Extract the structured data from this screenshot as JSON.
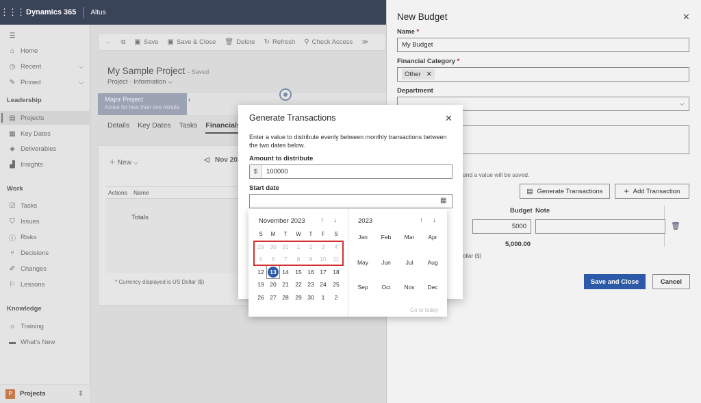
{
  "topbar": {
    "waffle": "⋮⋮⋮",
    "app_name": "Dynamics 365",
    "environment": "Altus"
  },
  "sidebar": {
    "top_items": [
      {
        "label": "Home",
        "icon": "home-icon"
      },
      {
        "label": "Recent",
        "icon": "clock-icon"
      },
      {
        "label": "Pinned",
        "icon": "pin-icon"
      }
    ],
    "groups": [
      {
        "title": "Leadership",
        "items": [
          {
            "label": "Projects",
            "icon": "projects-icon",
            "active": true
          },
          {
            "label": "Key Dates",
            "icon": "calendar-icon"
          },
          {
            "label": "Deliverables",
            "icon": "cube-icon"
          },
          {
            "label": "Insights",
            "icon": "chart-icon"
          }
        ]
      },
      {
        "title": "Work",
        "items": [
          {
            "label": "Tasks",
            "icon": "checkbox-icon"
          },
          {
            "label": "Issues",
            "icon": "shield-icon"
          },
          {
            "label": "Risks",
            "icon": "alert-icon"
          },
          {
            "label": "Decisions",
            "icon": "branch-icon"
          },
          {
            "label": "Changes",
            "icon": "edit-icon"
          },
          {
            "label": "Lessons",
            "icon": "flag-icon"
          }
        ]
      },
      {
        "title": "Knowledge",
        "items": [
          {
            "label": "Training",
            "icon": "lightbulb-icon"
          },
          {
            "label": "What's New",
            "icon": "news-icon"
          }
        ]
      }
    ],
    "area_badge": "P",
    "area_label": "Projects"
  },
  "commandbar": [
    "Save",
    "Save & Close",
    "Delete",
    "Refresh",
    "Check Access"
  ],
  "record": {
    "title": "My Sample Project",
    "saved": "- Saved",
    "entity": "Project",
    "form": "Information"
  },
  "stage": {
    "name": "Major Project",
    "sub": "Active for less than one minute"
  },
  "tabs": [
    "Details",
    "Key Dates",
    "Tasks",
    "Financials"
  ],
  "grid": {
    "new_label": "New",
    "period": "Nov 202",
    "col_actions": "Actions",
    "col_name": "Name",
    "totals": "Totals",
    "currency_note": "* Currency displayed is US Dollar ($)"
  },
  "panel": {
    "title": "New Budget",
    "name_label": "Name",
    "name_value": "My Budget",
    "category_label": "Financial Category",
    "category_value": "Other",
    "department_label": "Department",
    "hint": "and a value will be saved.",
    "generate_btn": "Generate Transactions",
    "add_btn": "Add Transaction",
    "col_budget": "Budget",
    "col_note": "Note",
    "budget_value": "5000",
    "budget_total": "5,000.00",
    "currency_note": "ollar ($)",
    "save_close": "Save and Close",
    "cancel": "Cancel"
  },
  "dialog": {
    "title": "Generate Transactions",
    "description": "Enter a value to distribute evenly between monthly transactions between the two dates below.",
    "amount_label": "Amount to distribute",
    "currency_symbol": "$",
    "amount_value": "100000",
    "start_label": "Start date"
  },
  "calendar": {
    "month_title": "November 2023",
    "weekdays": [
      "S",
      "M",
      "T",
      "W",
      "T",
      "F",
      "S"
    ],
    "weeks": [
      [
        {
          "d": "29",
          "dim": true
        },
        {
          "d": "30",
          "dim": true
        },
        {
          "d": "31",
          "dim": true
        },
        {
          "d": "1",
          "dim": true
        },
        {
          "d": "2",
          "dim": true
        },
        {
          "d": "3",
          "dim": true
        },
        {
          "d": "4",
          "dim": true
        }
      ],
      [
        {
          "d": "5",
          "dim": true
        },
        {
          "d": "6",
          "dim": true
        },
        {
          "d": "7",
          "dim": true
        },
        {
          "d": "8",
          "dim": true
        },
        {
          "d": "9",
          "dim": true
        },
        {
          "d": "10",
          "dim": true
        },
        {
          "d": "11",
          "dim": true
        }
      ],
      [
        {
          "d": "12"
        },
        {
          "d": "13",
          "today": true
        },
        {
          "d": "14"
        },
        {
          "d": "15"
        },
        {
          "d": "16"
        },
        {
          "d": "17"
        },
        {
          "d": "18"
        }
      ],
      [
        {
          "d": "19"
        },
        {
          "d": "20"
        },
        {
          "d": "21"
        },
        {
          "d": "22"
        },
        {
          "d": "23"
        },
        {
          "d": "24"
        },
        {
          "d": "25"
        }
      ],
      [
        {
          "d": "26"
        },
        {
          "d": "27"
        },
        {
          "d": "28"
        },
        {
          "d": "29"
        },
        {
          "d": "30"
        },
        {
          "d": "1"
        },
        {
          "d": "2"
        }
      ]
    ],
    "year_title": "2023",
    "months": [
      "Jan",
      "Feb",
      "Mar",
      "Apr",
      "May",
      "Jun",
      "Jul",
      "Aug",
      "Sep",
      "Oct",
      "Nov",
      "Dec"
    ],
    "goto_today": "Go to today",
    "accent": "#2c5aa8",
    "highlight": "#d32f2f"
  }
}
